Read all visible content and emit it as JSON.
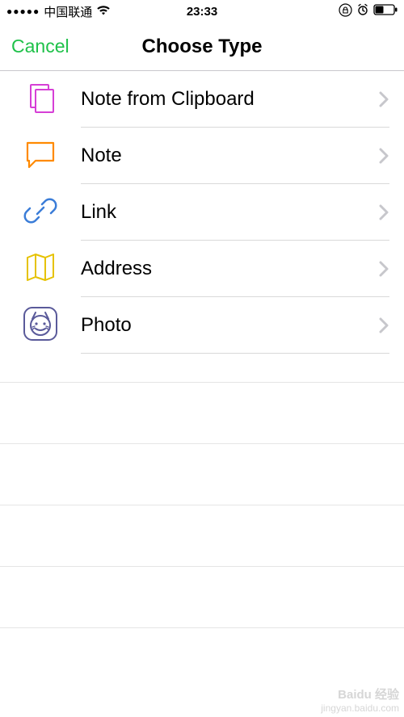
{
  "status": {
    "signal_dots": "●●●●●",
    "carrier": "中国联通",
    "time": "23:33"
  },
  "nav": {
    "cancel": "Cancel",
    "title": "Choose Type"
  },
  "types": [
    {
      "label": "Note from Clipboard",
      "icon": "clipboard-icon",
      "color": "#d63fd6"
    },
    {
      "label": "Note",
      "icon": "note-icon",
      "color": "#ff8a00"
    },
    {
      "label": "Link",
      "icon": "link-icon",
      "color": "#3b7dd8"
    },
    {
      "label": "Address",
      "icon": "address-icon",
      "color": "#e6c200"
    },
    {
      "label": "Photo",
      "icon": "photo-icon",
      "color": "#4a4a8a"
    }
  ],
  "watermark": {
    "line1": "Baidu 经验",
    "line2": "jingyan.baidu.com"
  }
}
